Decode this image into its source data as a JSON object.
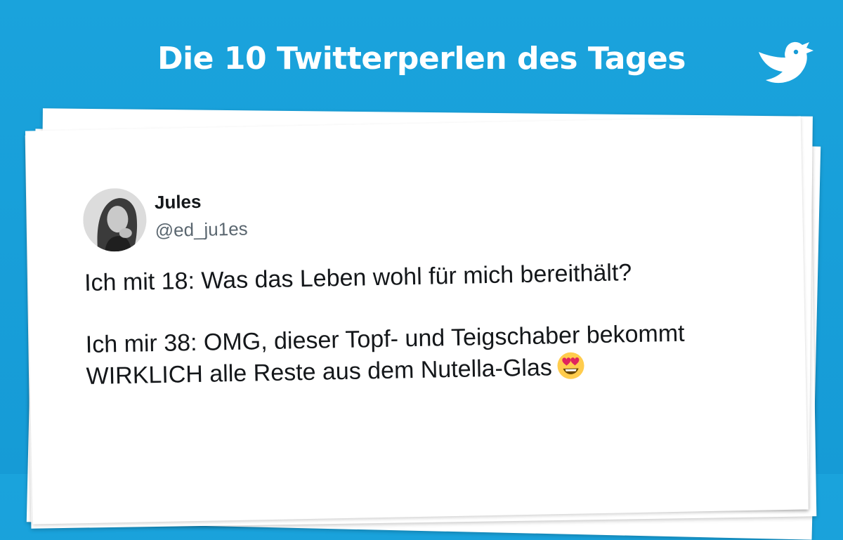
{
  "header": {
    "title": "Die 10 Twitterperlen des Tages",
    "logo_icon": "twitter-bird-icon"
  },
  "tweet": {
    "author_name": "Jules",
    "author_handle": "@ed_ju1es",
    "line1": "Ich mit 18: Was das Leben wohl für mich bereithält?",
    "line2": "Ich mir 38: OMG, dieser Topf- und Teigschaber bekommt WIRKLICH alle Reste aus dem Nutella-Glas",
    "emoji": "heart-eyes-emoji"
  },
  "colors": {
    "background": "#1aa3dc",
    "card": "#ffffff",
    "text": "#14171a",
    "handle": "#5b6770"
  }
}
